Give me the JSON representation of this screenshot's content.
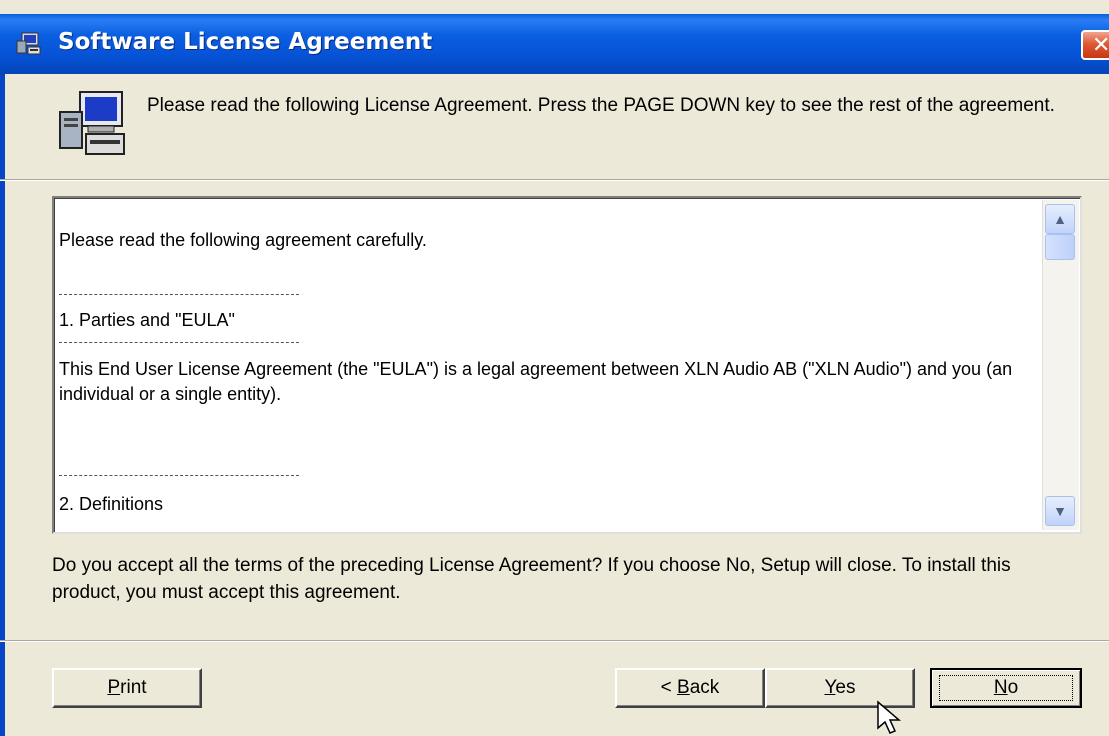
{
  "window": {
    "title": "Software License Agreement",
    "icon": "setup-computer-icon",
    "close_glyph": "✕"
  },
  "header": {
    "instruction": "Please read the following License Agreement. Press the PAGE DOWN key to see the rest of the agreement.",
    "icon": "computer-setup-icon"
  },
  "license": {
    "intro": "Please read the following agreement carefully.",
    "section1_title": "1. Parties and \"EULA\"",
    "section1_body": "This End User License Agreement (the \"EULA\") is a legal agreement between XLN Audio AB (\"XLN Audio\") and you (an individual or a single entity).",
    "section2_title": "2. Definitions"
  },
  "scrollbar": {
    "up_glyph": "▲",
    "down_glyph": "▼"
  },
  "question": "Do you accept all the terms of the preceding License Agreement? If you choose No, Setup will close. To install this product, you must accept this agreement.",
  "buttons": {
    "print": {
      "prefix": "",
      "accel": "P",
      "rest": "rint"
    },
    "back": {
      "prefix": "< ",
      "accel": "B",
      "rest": "ack"
    },
    "yes": {
      "prefix": "",
      "accel": "Y",
      "rest": "es"
    },
    "no": {
      "prefix": "",
      "accel": "N",
      "rest": "o"
    }
  }
}
